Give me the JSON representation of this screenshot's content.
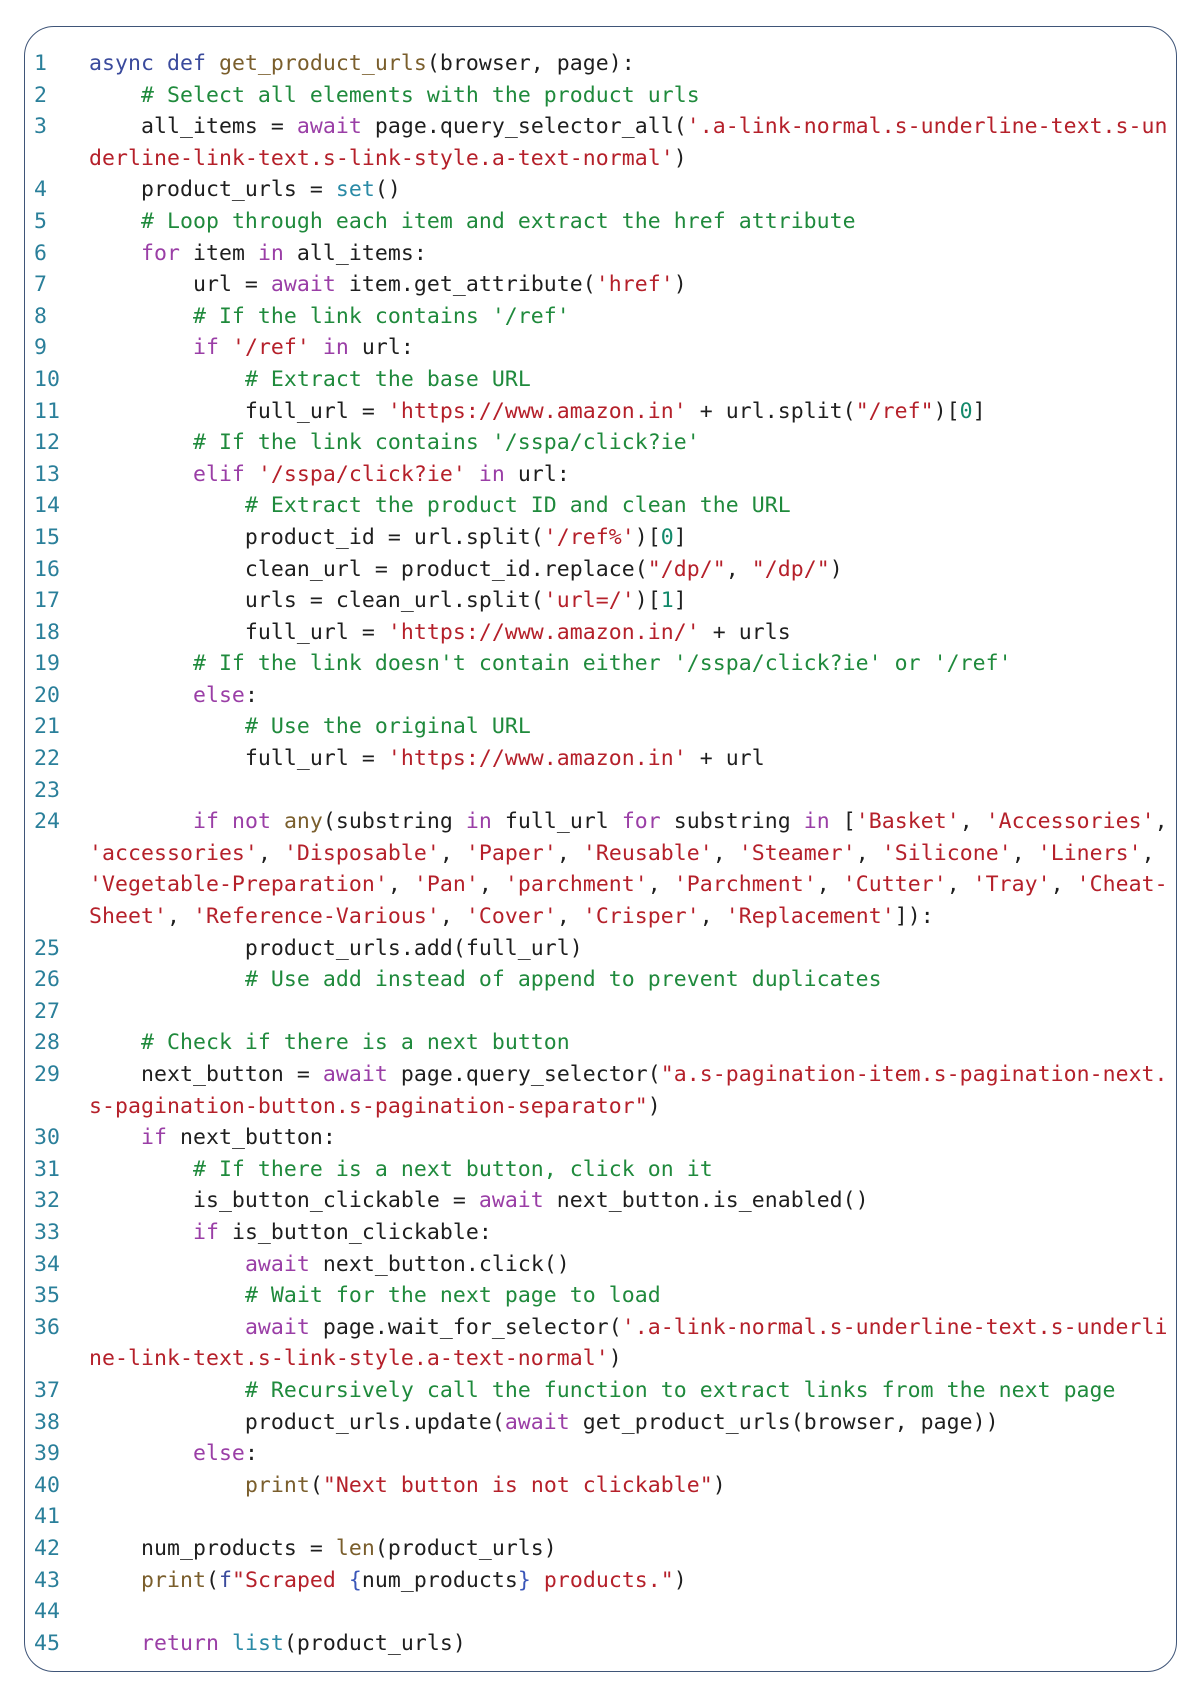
{
  "colors": {
    "border": "#3f5578",
    "line_number": "#2a7f9a",
    "keyword": "#3a4a9c",
    "function": "#7a5e2c",
    "control": "#9a3ea6",
    "builtin": "#2a8aa6",
    "comment": "#1f8a3c",
    "string": "#b5202a",
    "number": "#13896a"
  },
  "code": {
    "lines": [
      {
        "n": "1",
        "rows": [
          [
            [
              "k",
              "async def "
            ],
            [
              "f",
              "get_product_urls"
            ],
            [
              "p",
              "(browser, page):"
            ]
          ]
        ]
      },
      {
        "n": "2",
        "rows": [
          [
            [
              "p",
              "    "
            ],
            [
              "m",
              "# Select all elements with the product urls"
            ]
          ]
        ]
      },
      {
        "n": "3",
        "rows": [
          [
            [
              "p",
              "    all_items = "
            ],
            [
              "c",
              "await"
            ],
            [
              "p",
              " page.query_selector_all("
            ],
            [
              "s",
              "'.a-link-normal.s-underline-text.s-un"
            ]
          ],
          [
            [
              "s",
              "derline-link-text.s-link-style.a-text-normal'"
            ],
            [
              "p",
              ")"
            ]
          ]
        ]
      },
      {
        "n": "4",
        "rows": [
          [
            [
              "p",
              "    product_urls = "
            ],
            [
              "b",
              "set"
            ],
            [
              "p",
              "()"
            ]
          ]
        ]
      },
      {
        "n": "5",
        "rows": [
          [
            [
              "p",
              "    "
            ],
            [
              "m",
              "# Loop through each item and extract the href attribute"
            ]
          ]
        ]
      },
      {
        "n": "6",
        "rows": [
          [
            [
              "p",
              "    "
            ],
            [
              "c",
              "for"
            ],
            [
              "p",
              " item "
            ],
            [
              "c",
              "in"
            ],
            [
              "p",
              " all_items:"
            ]
          ]
        ]
      },
      {
        "n": "7",
        "rows": [
          [
            [
              "p",
              "        url = "
            ],
            [
              "c",
              "await"
            ],
            [
              "p",
              " item.get_attribute("
            ],
            [
              "s",
              "'href'"
            ],
            [
              "p",
              ")"
            ]
          ]
        ]
      },
      {
        "n": "8",
        "rows": [
          [
            [
              "p",
              "        "
            ],
            [
              "m",
              "# If the link contains '/ref'"
            ]
          ]
        ]
      },
      {
        "n": "9",
        "rows": [
          [
            [
              "p",
              "        "
            ],
            [
              "c",
              "if"
            ],
            [
              "p",
              " "
            ],
            [
              "s",
              "'/ref'"
            ],
            [
              "p",
              " "
            ],
            [
              "c",
              "in"
            ],
            [
              "p",
              " url:"
            ]
          ]
        ]
      },
      {
        "n": "10",
        "rows": [
          [
            [
              "p",
              "            "
            ],
            [
              "m",
              "# Extract the base URL"
            ]
          ]
        ]
      },
      {
        "n": "11",
        "rows": [
          [
            [
              "p",
              "            full_url = "
            ],
            [
              "s",
              "'https://www.amazon.in'"
            ],
            [
              "p",
              " + url.split("
            ],
            [
              "s",
              "\"/ref\""
            ],
            [
              "p",
              ")["
            ],
            [
              "n",
              "0"
            ],
            [
              "p",
              "]"
            ]
          ]
        ]
      },
      {
        "n": "12",
        "rows": [
          [
            [
              "p",
              "        "
            ],
            [
              "m",
              "# If the link contains '/sspa/click?ie'"
            ]
          ]
        ]
      },
      {
        "n": "13",
        "rows": [
          [
            [
              "p",
              "        "
            ],
            [
              "c",
              "elif"
            ],
            [
              "p",
              " "
            ],
            [
              "s",
              "'/sspa/click?ie'"
            ],
            [
              "p",
              " "
            ],
            [
              "c",
              "in"
            ],
            [
              "p",
              " url:"
            ]
          ]
        ]
      },
      {
        "n": "14",
        "rows": [
          [
            [
              "p",
              "            "
            ],
            [
              "m",
              "# Extract the product ID and clean the URL"
            ]
          ]
        ]
      },
      {
        "n": "15",
        "rows": [
          [
            [
              "p",
              "            product_id = url.split("
            ],
            [
              "s",
              "'/ref%'"
            ],
            [
              "p",
              ")["
            ],
            [
              "n",
              "0"
            ],
            [
              "p",
              "]"
            ]
          ]
        ]
      },
      {
        "n": "16",
        "rows": [
          [
            [
              "p",
              "            clean_url = product_id.replace("
            ],
            [
              "s",
              "\"/dp/\""
            ],
            [
              "p",
              ", "
            ],
            [
              "s",
              "\"/dp/\""
            ],
            [
              "p",
              ")"
            ]
          ]
        ]
      },
      {
        "n": "17",
        "rows": [
          [
            [
              "p",
              "            urls = clean_url.split("
            ],
            [
              "s",
              "'url=/'"
            ],
            [
              "p",
              ")["
            ],
            [
              "n",
              "1"
            ],
            [
              "p",
              "]"
            ]
          ]
        ]
      },
      {
        "n": "18",
        "rows": [
          [
            [
              "p",
              "            full_url = "
            ],
            [
              "s",
              "'https://www.amazon.in/'"
            ],
            [
              "p",
              " + urls"
            ]
          ]
        ]
      },
      {
        "n": "19",
        "rows": [
          [
            [
              "p",
              "        "
            ],
            [
              "m",
              "# If the link doesn't contain either '/sspa/click?ie' or '/ref'"
            ]
          ]
        ]
      },
      {
        "n": "20",
        "rows": [
          [
            [
              "p",
              "        "
            ],
            [
              "c",
              "else"
            ],
            [
              "p",
              ":"
            ]
          ]
        ]
      },
      {
        "n": "21",
        "rows": [
          [
            [
              "p",
              "            "
            ],
            [
              "m",
              "# Use the original URL"
            ]
          ]
        ]
      },
      {
        "n": "22",
        "rows": [
          [
            [
              "p",
              "            full_url = "
            ],
            [
              "s",
              "'https://www.amazon.in'"
            ],
            [
              "p",
              " + url"
            ]
          ]
        ]
      },
      {
        "n": "23",
        "rows": [
          []
        ]
      },
      {
        "n": "24",
        "rows": [
          [
            [
              "p",
              "        "
            ],
            [
              "c",
              "if"
            ],
            [
              "p",
              " "
            ],
            [
              "c",
              "not"
            ],
            [
              "p",
              " "
            ],
            [
              "f",
              "any"
            ],
            [
              "p",
              "(substring "
            ],
            [
              "c",
              "in"
            ],
            [
              "p",
              " full_url "
            ],
            [
              "c",
              "for"
            ],
            [
              "p",
              " substring "
            ],
            [
              "c",
              "in"
            ],
            [
              "p",
              " ["
            ],
            [
              "s",
              "'Basket'"
            ],
            [
              "p",
              ", "
            ],
            [
              "s",
              "'Accessories'"
            ],
            [
              "p",
              ","
            ]
          ],
          [
            [
              "s",
              "'accessories'"
            ],
            [
              "p",
              ", "
            ],
            [
              "s",
              "'Disposable'"
            ],
            [
              "p",
              ", "
            ],
            [
              "s",
              "'Paper'"
            ],
            [
              "p",
              ", "
            ],
            [
              "s",
              "'Reusable'"
            ],
            [
              "p",
              ", "
            ],
            [
              "s",
              "'Steamer'"
            ],
            [
              "p",
              ", "
            ],
            [
              "s",
              "'Silicone'"
            ],
            [
              "p",
              ", "
            ],
            [
              "s",
              "'Liners'"
            ],
            [
              "p",
              ","
            ]
          ],
          [
            [
              "s",
              "'Vegetable-Preparation'"
            ],
            [
              "p",
              ", "
            ],
            [
              "s",
              "'Pan'"
            ],
            [
              "p",
              ", "
            ],
            [
              "s",
              "'parchment'"
            ],
            [
              "p",
              ", "
            ],
            [
              "s",
              "'Parchment'"
            ],
            [
              "p",
              ", "
            ],
            [
              "s",
              "'Cutter'"
            ],
            [
              "p",
              ", "
            ],
            [
              "s",
              "'Tray'"
            ],
            [
              "p",
              ", "
            ],
            [
              "s",
              "'Cheat-"
            ]
          ],
          [
            [
              "s",
              "Sheet'"
            ],
            [
              "p",
              ", "
            ],
            [
              "s",
              "'Reference-Various'"
            ],
            [
              "p",
              ", "
            ],
            [
              "s",
              "'Cover'"
            ],
            [
              "p",
              ", "
            ],
            [
              "s",
              "'Crisper'"
            ],
            [
              "p",
              ", "
            ],
            [
              "s",
              "'Replacement'"
            ],
            [
              "p",
              "]):"
            ]
          ]
        ]
      },
      {
        "n": "25",
        "rows": [
          [
            [
              "p",
              "            product_urls.add(full_url)"
            ]
          ]
        ]
      },
      {
        "n": "26",
        "rows": [
          [
            [
              "p",
              "            "
            ],
            [
              "m",
              "# Use add instead of append to prevent duplicates"
            ]
          ]
        ]
      },
      {
        "n": "27",
        "rows": [
          []
        ]
      },
      {
        "n": "28",
        "rows": [
          [
            [
              "p",
              "    "
            ],
            [
              "m",
              "# Check if there is a next button"
            ]
          ]
        ]
      },
      {
        "n": "29",
        "rows": [
          [
            [
              "p",
              "    next_button = "
            ],
            [
              "c",
              "await"
            ],
            [
              "p",
              " page.query_selector("
            ],
            [
              "s",
              "\"a.s-pagination-item.s-pagination-next."
            ]
          ],
          [
            [
              "s",
              "s-pagination-button.s-pagination-separator\""
            ],
            [
              "p",
              ")"
            ]
          ]
        ]
      },
      {
        "n": "30",
        "rows": [
          [
            [
              "p",
              "    "
            ],
            [
              "c",
              "if"
            ],
            [
              "p",
              " next_button:"
            ]
          ]
        ]
      },
      {
        "n": "31",
        "rows": [
          [
            [
              "p",
              "        "
            ],
            [
              "m",
              "# If there is a next button, click on it"
            ]
          ]
        ]
      },
      {
        "n": "32",
        "rows": [
          [
            [
              "p",
              "        is_button_clickable = "
            ],
            [
              "c",
              "await"
            ],
            [
              "p",
              " next_button.is_enabled()"
            ]
          ]
        ]
      },
      {
        "n": "33",
        "rows": [
          [
            [
              "p",
              "        "
            ],
            [
              "c",
              "if"
            ],
            [
              "p",
              " is_button_clickable:"
            ]
          ]
        ]
      },
      {
        "n": "34",
        "rows": [
          [
            [
              "p",
              "            "
            ],
            [
              "c",
              "await"
            ],
            [
              "p",
              " next_button.click()"
            ]
          ]
        ]
      },
      {
        "n": "35",
        "rows": [
          [
            [
              "p",
              "            "
            ],
            [
              "m",
              "# Wait for the next page to load"
            ]
          ]
        ]
      },
      {
        "n": "36",
        "rows": [
          [
            [
              "p",
              "            "
            ],
            [
              "c",
              "await"
            ],
            [
              "p",
              " page.wait_for_selector("
            ],
            [
              "s",
              "'.a-link-normal.s-underline-text.s-underli"
            ]
          ],
          [
            [
              "s",
              "ne-link-text.s-link-style.a-text-normal'"
            ],
            [
              "p",
              ")"
            ]
          ]
        ]
      },
      {
        "n": "37",
        "rows": [
          [
            [
              "p",
              "            "
            ],
            [
              "m",
              "# Recursively call the function to extract links from the next page"
            ]
          ]
        ]
      },
      {
        "n": "38",
        "rows": [
          [
            [
              "p",
              "            product_urls.update("
            ],
            [
              "c",
              "await"
            ],
            [
              "p",
              " get_product_urls(browser, page))"
            ]
          ]
        ]
      },
      {
        "n": "39",
        "rows": [
          [
            [
              "p",
              "        "
            ],
            [
              "c",
              "else"
            ],
            [
              "p",
              ":"
            ]
          ]
        ]
      },
      {
        "n": "40",
        "rows": [
          [
            [
              "p",
              "            "
            ],
            [
              "f",
              "print"
            ],
            [
              "p",
              "("
            ],
            [
              "s",
              "\"Next button is not clickable\""
            ],
            [
              "p",
              ")"
            ]
          ]
        ]
      },
      {
        "n": "41",
        "rows": [
          []
        ]
      },
      {
        "n": "42",
        "rows": [
          [
            [
              "p",
              "    num_products = "
            ],
            [
              "f",
              "len"
            ],
            [
              "p",
              "(product_urls)"
            ]
          ]
        ]
      },
      {
        "n": "43",
        "rows": [
          [
            [
              "p",
              "    "
            ],
            [
              "f",
              "print"
            ],
            [
              "p",
              "("
            ],
            [
              "k",
              "f"
            ],
            [
              "s",
              "\"Scraped "
            ],
            [
              "r",
              "{"
            ],
            [
              "p",
              "num_products"
            ],
            [
              "r",
              "}"
            ],
            [
              "s",
              " products.\""
            ],
            [
              "p",
              ")"
            ]
          ]
        ]
      },
      {
        "n": "44",
        "rows": [
          []
        ]
      },
      {
        "n": "45",
        "rows": [
          [
            [
              "p",
              "    "
            ],
            [
              "c",
              "return"
            ],
            [
              "p",
              " "
            ],
            [
              "b",
              "list"
            ],
            [
              "p",
              "(product_urls)"
            ]
          ]
        ]
      }
    ]
  }
}
